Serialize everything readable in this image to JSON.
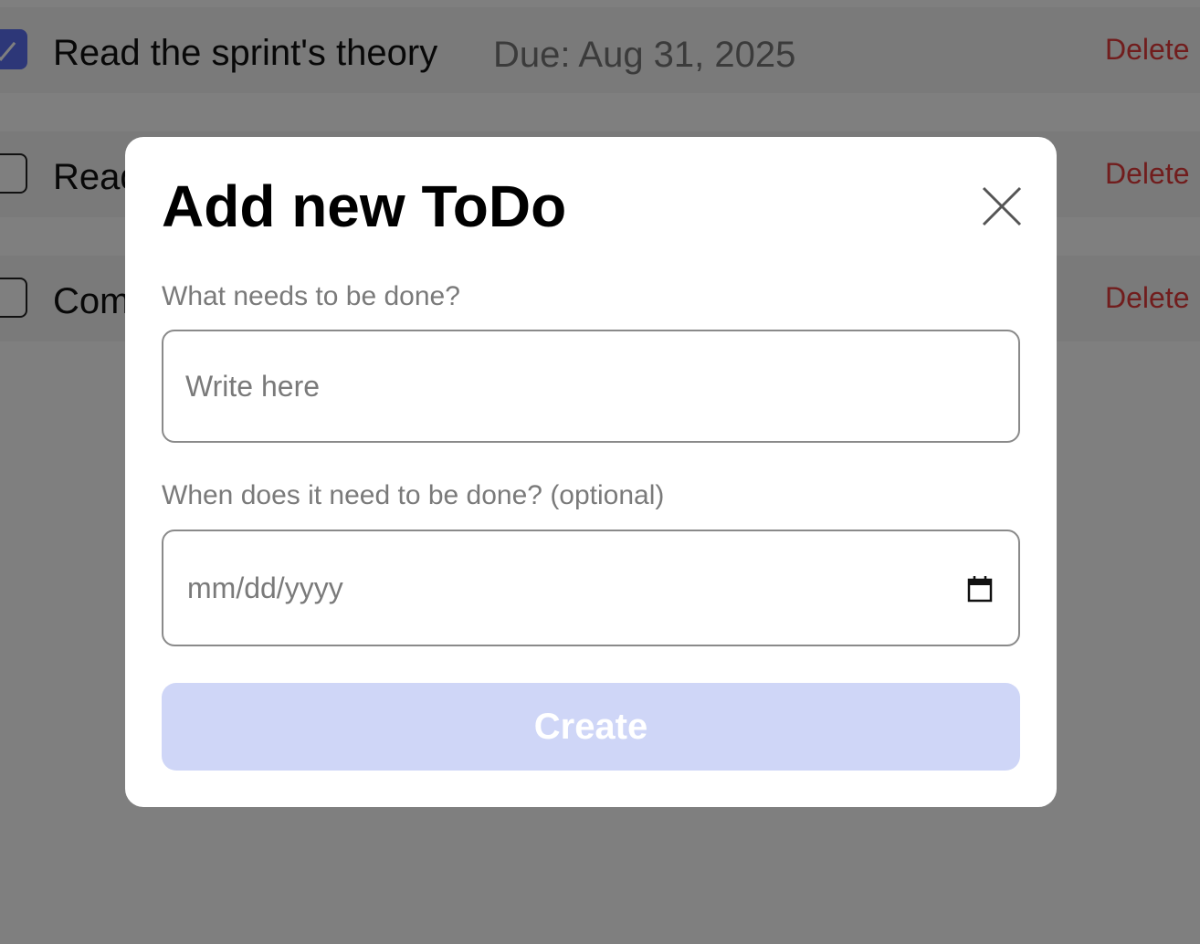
{
  "todos": [
    {
      "text": "Read the sprint's theory",
      "due": "Due: Aug 31, 2025",
      "checked": true,
      "delete_label": "Delete"
    },
    {
      "text": "Read",
      "due": "",
      "checked": false,
      "delete_label": "Delete"
    },
    {
      "text": "Com",
      "due": "",
      "checked": false,
      "delete_label": "Delete"
    }
  ],
  "modal": {
    "title": "Add new ToDo",
    "close_icon": "close-icon",
    "task_label": "What needs to be done?",
    "task_placeholder": "Write here",
    "date_label": "When does it need to be done? (optional)",
    "date_placeholder": "mm/dd/yyyy",
    "calendar_icon": "calendar-icon",
    "create_label": "Create"
  },
  "colors": {
    "accent": "#5b6ff0",
    "create_disabled": "#cfd6f7",
    "delete": "#e23a3a",
    "overlay": "rgba(0,0,0,0.5)"
  }
}
